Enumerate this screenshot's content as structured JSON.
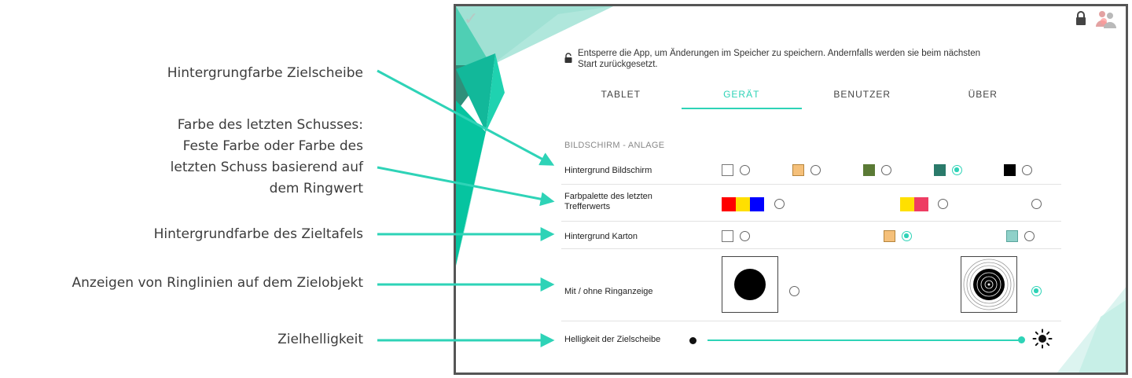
{
  "annotations": {
    "background_target": "Hintergrungfarbe Zielscheibe",
    "last_shot_color": [
      "Farbe des letzten Schusses:",
      "Feste Farbe oder Farbe des",
      "letzten Schuss basierend auf",
      "dem Ringwert"
    ],
    "board_background": "Hintergrundfarbe des Zieltafels",
    "ring_lines": "Anzeigen von Ringlinien auf dem Zielobjekt",
    "brightness": "Zielhelligkeit"
  },
  "notice": {
    "line1": "Entsperre die App, um Änderungen im Speicher zu speichern. Andernfalls werden sie beim nächsten",
    "line2": "Start zurückgesetzt."
  },
  "tabs": [
    {
      "label": "TABLET",
      "active": false
    },
    {
      "label": "GERÄT",
      "active": true
    },
    {
      "label": "BENUTZER",
      "active": false
    },
    {
      "label": "ÜBER",
      "active": false
    }
  ],
  "section_title": "BILDSCHIRM - ANLAGE",
  "rows": {
    "screen_background": {
      "label": "Hintergrund Bildschirm",
      "options": [
        "#ffffff",
        "#f5c07a",
        "#5a7a35",
        "#2a7a6a",
        "#000000"
      ],
      "selected_index": 3
    },
    "palette": {
      "label_line1": "Farbpalette des letzten",
      "label_line2": "Trefferwerts",
      "options": [
        [
          "#ff0000",
          "#ffdf00",
          "#0000ff"
        ],
        [
          "#ffe000",
          "#ee3d63"
        ],
        []
      ],
      "selected_index": -1
    },
    "board_background": {
      "label": "Hintergrund Karton",
      "options": [
        "#ffffff",
        "#f5c07a",
        "#8fd1c9"
      ],
      "selected_index": 1
    },
    "rings": {
      "label": "Mit / ohne Ringanzeige",
      "options": [
        "ohne",
        "mit"
      ],
      "selected_index": 1
    },
    "brightness": {
      "label": "Helligkeit der Zielscheibe",
      "value": 1.0
    }
  },
  "colors": {
    "accent": "#2ed3b7",
    "arrow": "#2ed3b7"
  },
  "icons": {
    "check": "✓",
    "sun": "sun-icon",
    "lock": "lock-icon",
    "users": "users-icon"
  }
}
